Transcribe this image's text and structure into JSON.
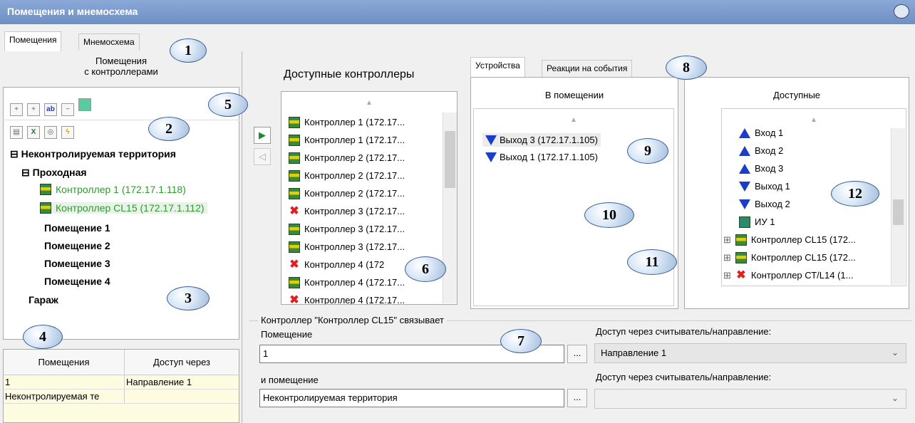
{
  "title": "Помещения и мнемосхема",
  "tabs": {
    "rooms": "Помещения",
    "mnemo": "Мнемосхема"
  },
  "left": {
    "header": "Помещения\nс контроллерами",
    "tree": {
      "root": "Неконтролируемая территория",
      "passage": "Проходная",
      "ctrl1": "Контроллер 1 (172.17.1.118)",
      "ctrl2": "Контроллер CL15 (172.17.1.112)",
      "room1": "Помещение 1",
      "room2": "Помещение 2",
      "room3": "Помещение 3",
      "room4": "Помещение 4",
      "garage": "Гараж"
    },
    "table": {
      "col1": "Помещения",
      "col2": "Доступ через",
      "rows": [
        {
          "a": "1",
          "b": "Направление 1"
        },
        {
          "a": "Неконтролируемая те",
          "b": ""
        }
      ]
    }
  },
  "available_controllers": {
    "title": "Доступные контроллеры",
    "items": [
      {
        "label": "Контроллер 1 (172.17...",
        "icon": "controller"
      },
      {
        "label": "Контроллер 1 (172.17...",
        "icon": "controller"
      },
      {
        "label": "Контроллер 2 (172.17...",
        "icon": "controller"
      },
      {
        "label": "Контроллер 2 (172.17...",
        "icon": "controller"
      },
      {
        "label": "Контроллер 2 (172.17...",
        "icon": "controller"
      },
      {
        "label": "Контроллер 3 (172.17...",
        "icon": "error"
      },
      {
        "label": "Контроллер 3 (172.17...",
        "icon": "controller"
      },
      {
        "label": "Контроллер 3 (172.17...",
        "icon": "controller"
      },
      {
        "label": "Контроллер 4 (172",
        "icon": "error"
      },
      {
        "label": "Контроллер 4 (172.17...",
        "icon": "controller"
      },
      {
        "label": "Контроллер 4 (172.17...",
        "icon": "error"
      }
    ]
  },
  "right_tabs": {
    "devices": "Устройства",
    "reactions": "Реакции на события"
  },
  "in_room": {
    "title": "В помещении",
    "items": [
      "Выход 3 (172.17.1.105)",
      "Выход 1 (172.17.1.105)"
    ]
  },
  "available": {
    "title": "Доступные",
    "items": [
      {
        "label": "Вход 1",
        "icon": "entry"
      },
      {
        "label": "Вход 2",
        "icon": "entry"
      },
      {
        "label": "Вход 3",
        "icon": "entry"
      },
      {
        "label": "Выход 1",
        "icon": "exit"
      },
      {
        "label": "Выход 2",
        "icon": "exit"
      },
      {
        "label": "ИУ 1",
        "icon": "actuator"
      },
      {
        "label": "Контроллер CL15 (172...",
        "icon": "controller"
      },
      {
        "label": "Контроллер CL15 (172...",
        "icon": "controller"
      },
      {
        "label": "Контроллер СТ/L14 (1...",
        "icon": "error"
      }
    ]
  },
  "link": {
    "legend": "Контроллер \"Контроллер CL15\" связывает",
    "room_label": "Помещение",
    "room_value": "1",
    "and_room_label": "и помещение",
    "and_room_value": "Неконтролируемая территория",
    "access_label1": "Доступ через считыватель/направление:",
    "access_value1": "Направление 1",
    "access_label2": "Доступ через считыватель/направление:",
    "access_value2": "",
    "dots": "..."
  },
  "callouts": [
    "1",
    "2",
    "3",
    "4",
    "5",
    "6",
    "7",
    "8",
    "9",
    "10",
    "11",
    "12"
  ]
}
